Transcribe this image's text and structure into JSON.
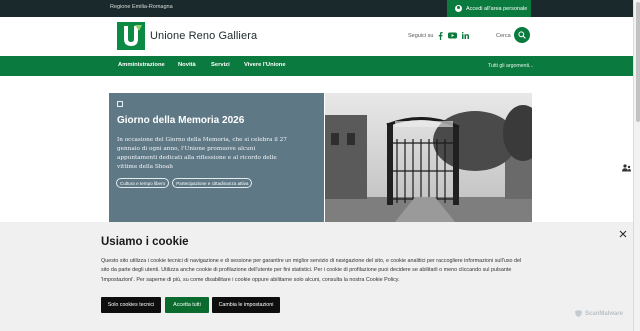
{
  "topbar": {
    "region": "Regione Emilia-Romagna",
    "login_label": "Accedi all'area personale"
  },
  "header": {
    "site_title": "Unione Reno Galliera",
    "follow_label": "Seguici su",
    "search_label": "Cerca"
  },
  "social": [
    "facebook-icon",
    "youtube-icon",
    "linkedin-icon"
  ],
  "nav": {
    "items": [
      "Amministrazione",
      "Novità",
      "Servizi",
      "Vivere l'Unione"
    ],
    "all_topics": "Tutti gli argomenti..."
  },
  "hero": {
    "title": "Giorno della Memoria 2026",
    "body": "In occasione del Giorno della Memoria, che si celebra il 27 gennaio di ogni anno, l'Unione promuove alcuni appuntamenti dedicati alla riflessione e al ricordo delle vittime della Shoah",
    "tags": [
      "Cultura e tempo libero",
      "Partecipazione e cittadinanza attiva"
    ]
  },
  "cookie": {
    "title": "Usiamo i cookie",
    "text": "Questo sito utilizza i cookie tecnici di navigazione e di sessione per garantire un miglior servizio di navigazione del sito, e cookie analitici per raccogliere informazioni sull'uso del sito da parte degli utenti. Utilizza anche cookie di profilazione dell'utente per fini statistici. Per i cookie di profilazione puoi decidere se abilitarli o meno cliccando sul pulsante 'Impostazioni'. Per saperne di più, su come disabilitare i cookie oppure abilitarne solo alcuni, consulta la nostra Cookie Policy.",
    "buttons": {
      "technical": "Solo cookies tecnici",
      "accept": "Accetta tutti",
      "settings": "Cambia le impostazioni"
    }
  },
  "watermark": "ScanMalware",
  "colors": {
    "brand_green": "#0b7a3e",
    "dark_bar": "#1a2a2c",
    "hero_card": "#5f7886"
  }
}
